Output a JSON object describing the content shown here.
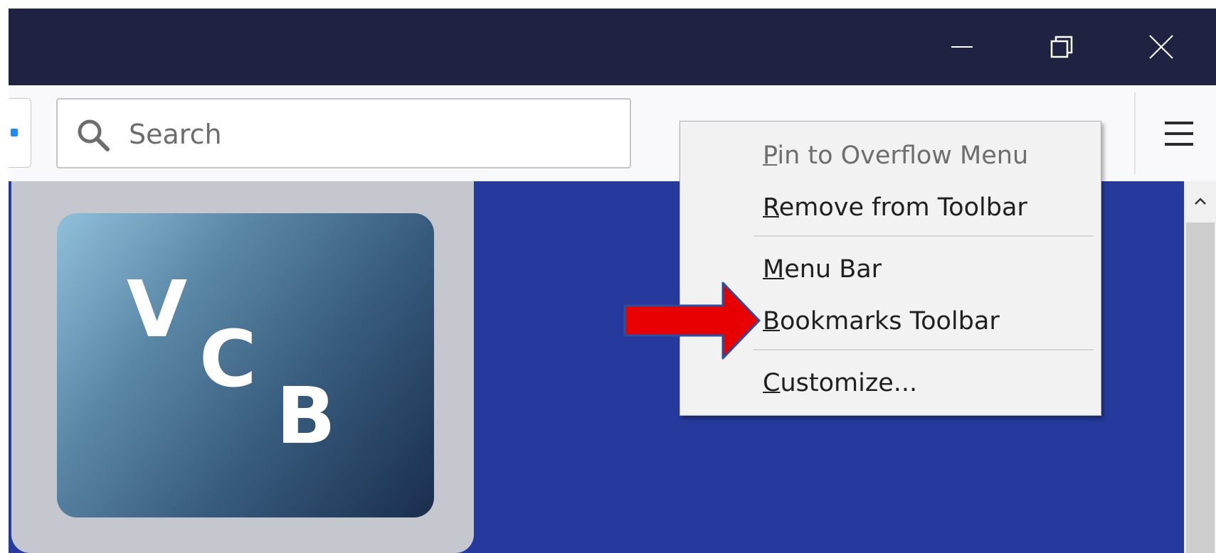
{
  "window_controls": {
    "minimize_icon": "minimize-icon",
    "maximize_icon": "restore-icon",
    "close_icon": "close-icon"
  },
  "toolbar": {
    "search": {
      "placeholder": "Search",
      "icon": "search-icon"
    },
    "menu_icon": "hamburger-menu-icon"
  },
  "logo": {
    "letters": [
      "V",
      "C",
      "B"
    ],
    "gradient_start": "#90c0da",
    "gradient_end": "#1a2e4d"
  },
  "context_menu": {
    "items": [
      {
        "accel": "P",
        "rest": "in to Overflow Menu",
        "disabled": true
      },
      {
        "accel": "R",
        "rest": "emove from Toolbar",
        "disabled": false
      },
      {
        "accel": "M",
        "rest": "enu Bar",
        "disabled": false
      },
      {
        "accel": "B",
        "rest": "ookmarks Toolbar",
        "disabled": false
      },
      {
        "accel": "C",
        "rest": "ustomize...",
        "disabled": false
      }
    ]
  },
  "annotation": {
    "arrow_color": "#e60000",
    "arrow_outline": "#2b4ea0",
    "points_to": "Bookmarks Toolbar"
  },
  "colors": {
    "titlebar": "#1f2341",
    "content_background": "#263a9d",
    "menu_background": "#f2f2f2"
  }
}
